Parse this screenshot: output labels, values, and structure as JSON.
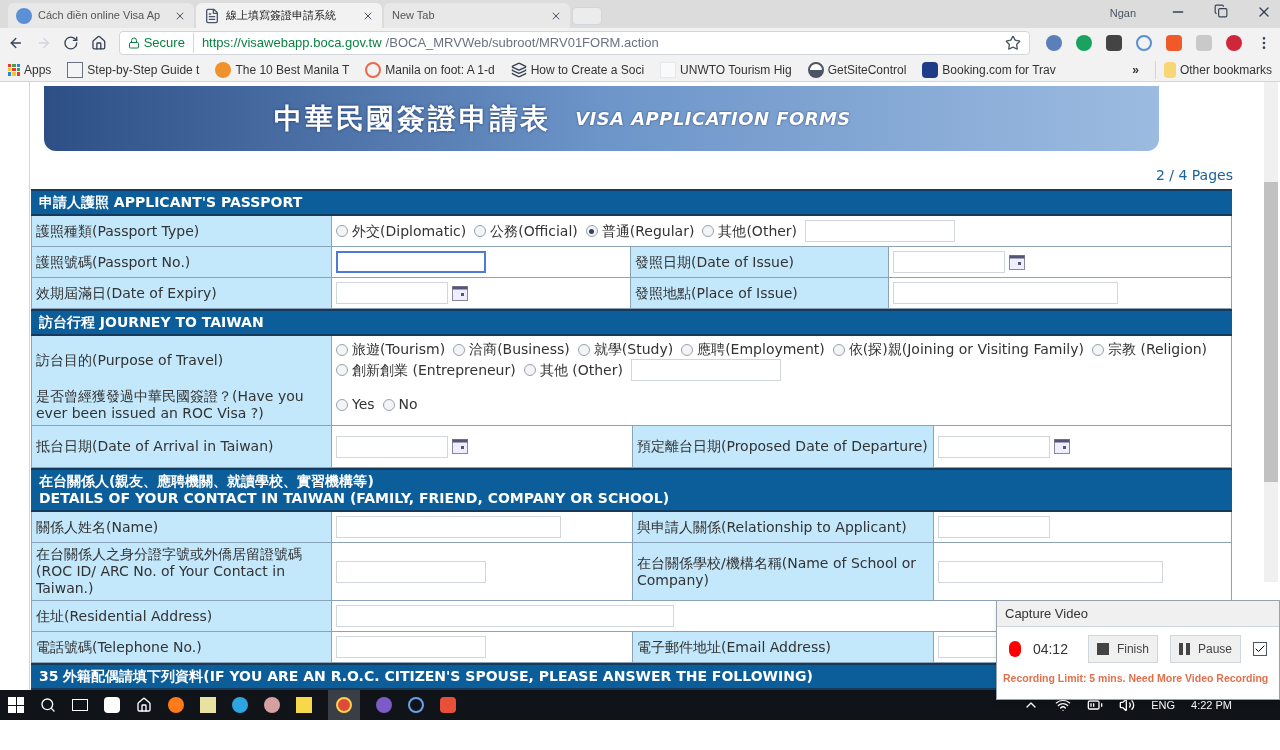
{
  "browser": {
    "tabs": [
      {
        "title": "Cách điền online Visa Ap",
        "selected": false
      },
      {
        "title": "線上填寫簽證申請系統",
        "selected": true
      },
      {
        "title": "New Tab",
        "selected": false
      }
    ],
    "profile": "Ngan",
    "address": {
      "secure": "Secure",
      "host": "https://visawebapp.boca.gov.tw",
      "path": "/BOCA_MRVWeb/subroot/MRV01FORM.action"
    },
    "bookmarks": [
      "Apps",
      "Step-by-Step Guide t",
      "The 10 Best Manila T",
      "Manila on foot: A 1-d",
      "How to Create a Soci",
      "UNWTO Tourism Hig",
      "GetSiteControl",
      "Booking.com for Trav"
    ],
    "more_bookmarks": "»",
    "other_bookmarks": "Other bookmarks"
  },
  "page": {
    "banner": {
      "title_zh": "中華民國簽證申請表",
      "title_en": "VISA APPLICATION FORMS"
    },
    "page_indicator": "2 / 4 Pages",
    "sections": [
      {
        "title": [
          "申請人護照 APPLICANT'S PASSPORT"
        ],
        "rows": [
          [
            {
              "kind": "label",
              "text": "護照種類(Passport Type)"
            },
            {
              "kind": "radios",
              "with_field": true,
              "options": [
                {
                  "label": "外交(Diplomatic)",
                  "selected": false
                },
                {
                  "label": "公務(Official)",
                  "selected": false
                },
                {
                  "label": "普通(Regular)",
                  "selected": true
                },
                {
                  "label": "其他(Other)",
                  "selected": false
                }
              ]
            }
          ],
          [
            {
              "kind": "label",
              "text": "護照號碼(Passport No.)"
            },
            {
              "kind": "text_field",
              "focused": true
            },
            {
              "kind": "label",
              "text": "發照日期(Date of Issue)"
            },
            {
              "kind": "date_field",
              "focused": false
            }
          ],
          [
            {
              "kind": "label",
              "text": "效期屆滿日(Date of Expiry)"
            },
            {
              "kind": "date_field",
              "focused": false
            },
            {
              "kind": "label",
              "text": "發照地點(Place of Issue)"
            },
            {
              "kind": "wide_field",
              "focused": false
            }
          ]
        ]
      },
      {
        "title": [
          "訪台行程 JOURNEY TO TAIWAN"
        ],
        "rows": [
          [
            {
              "kind": "label",
              "text": "訪台目的(Purpose of Travel)"
            },
            {
              "kind": "radios",
              "with_field": true,
              "options": [
                {
                  "label": "旅遊(Tourism)",
                  "selected": false
                },
                {
                  "label": "洽商(Business)",
                  "selected": false
                },
                {
                  "label": "就學(Study)",
                  "selected": false
                },
                {
                  "label": "應聘(Employment)",
                  "selected": false
                },
                {
                  "label": "依(探)親(Joining or Visiting Family)",
                  "selected": false
                },
                {
                  "label": "宗教 (Religion)",
                  "selected": false
                },
                {
                  "label": "創新創業 (Entrepreneur)",
                  "selected": false
                },
                {
                  "label": "其他 (Other)",
                  "selected": false
                }
              ]
            }
          ],
          [
            {
              "kind": "label",
              "text": "是否曾經獲發過中華民國簽證？(Have you ever been issued an ROC Visa ?)"
            },
            {
              "kind": "radios",
              "with_field": false,
              "options": [
                {
                  "label": "Yes",
                  "selected": false
                },
                {
                  "label": "No",
                  "selected": false
                }
              ]
            }
          ],
          [
            {
              "kind": "label",
              "text": "抵台日期(Date of Arrival in Taiwan)"
            },
            {
              "kind": "date_field",
              "focused": false
            },
            {
              "kind": "label",
              "text": "預定離台日期(Proposed Date of Departure)"
            },
            {
              "kind": "date_field",
              "focused": false
            }
          ]
        ]
      },
      {
        "title": [
          "在台關係人(親友、應聘機關、就讀學校、實習機構等)",
          "DETAILS OF YOUR CONTACT IN TAIWAN (FAMILY, FRIEND, COMPANY OR SCHOOL)"
        ],
        "rows": [
          [
            {
              "kind": "label",
              "text": "關係人姓名(Name)"
            },
            {
              "kind": "wide_field",
              "focused": false
            },
            {
              "kind": "label",
              "text": "與申請人關係(Relationship to Applicant)"
            },
            {
              "kind": "short_field",
              "focused": false
            }
          ],
          [
            {
              "kind": "label",
              "text": "在台關係人之身分證字號或外僑居留證號碼(ROC ID/ ARC No. of Your Contact in Taiwan.)"
            },
            {
              "kind": "text_field",
              "focused": false
            },
            {
              "kind": "label",
              "text": "在台關係學校/機構名稱(Name of School or Company)"
            },
            {
              "kind": "wide_field",
              "focused": false
            }
          ],
          [
            {
              "kind": "label",
              "text": "住址(Residential Address)"
            },
            {
              "kind": "long_field",
              "focused": false
            }
          ],
          [
            {
              "kind": "label",
              "text": "電話號碼(Telephone No.)"
            },
            {
              "kind": "text_field",
              "focused": false
            },
            {
              "kind": "label",
              "text": "電子郵件地址(Email Address)"
            },
            {
              "kind": "short_field",
              "focused": false
            }
          ]
        ]
      },
      {
        "title": [
          "35 外籍配偶請填下列資料(IF YOU ARE AN R.O.C. CITIZEN'S SPOUSE, PLEASE ANSWER THE FOLLOWING)"
        ]
      }
    ]
  },
  "capture": {
    "title": "Capture Video",
    "recording": true,
    "time": "04:12",
    "buttons": [
      {
        "label": "Finish",
        "kind": "stop"
      },
      {
        "label": "Pause",
        "kind": "pause"
      }
    ],
    "checked": true,
    "warning": "Recording Limit: 5 mins. Need More Video Recording"
  },
  "taskbar": {
    "language": "ENG",
    "clock": "4:22 PM"
  }
}
